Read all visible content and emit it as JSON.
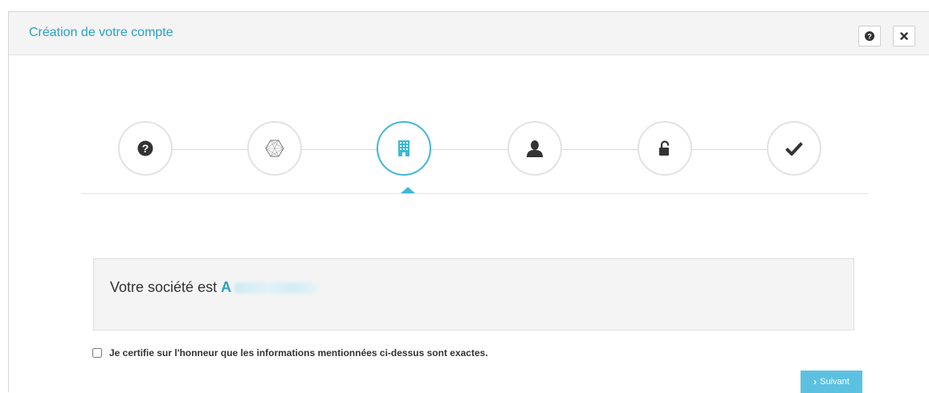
{
  "header": {
    "title": "Création de votre compte"
  },
  "steps": [
    {
      "icon": "question-circle-icon"
    },
    {
      "icon": "network-icon"
    },
    {
      "icon": "building-icon",
      "active": true
    },
    {
      "icon": "user-icon"
    },
    {
      "icon": "unlock-icon"
    },
    {
      "icon": "check-icon"
    }
  ],
  "company": {
    "label": "Votre société est",
    "name": "A"
  },
  "certify": {
    "label": "Je certifie sur l'honneur que les informations mentionnées ci-dessus sont exactes.",
    "checked": false
  },
  "next_button": {
    "label": "Suivant"
  },
  "colors": {
    "accent": "#2aa1c4",
    "button": "#5cc1e0",
    "icon": "#333333"
  }
}
